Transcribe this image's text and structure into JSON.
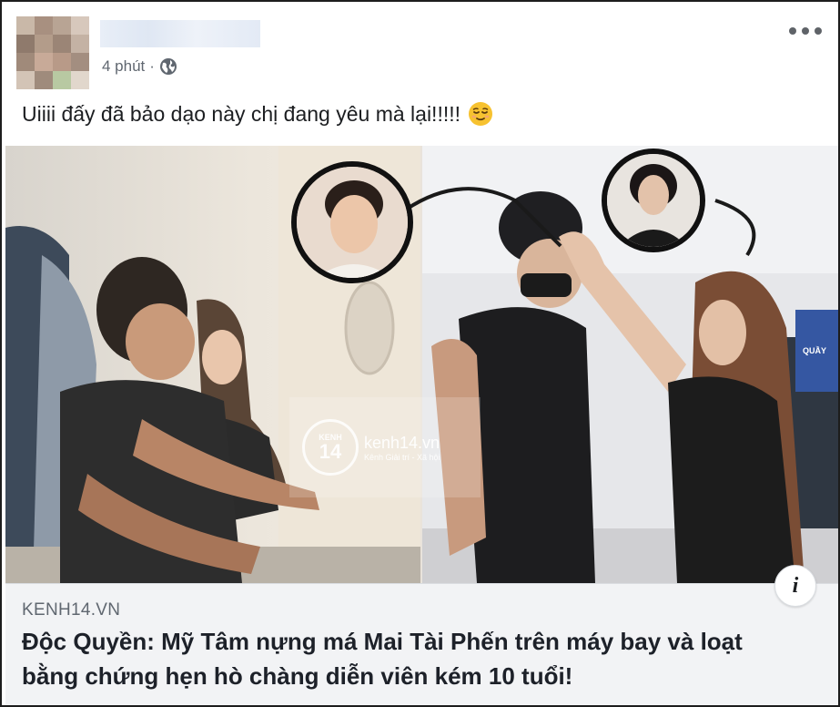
{
  "post": {
    "timestamp": "4 phút",
    "separator": "·",
    "privacy_icon": "globe-icon",
    "more_icon": "more-horizontal-icon",
    "text": "Uiiii đấy đã bảo dạo này chị đang yêu mà lại!!!!!",
    "emoji": "relieved-face-emoji"
  },
  "photo": {
    "watermark_brand": "kenh14.vn",
    "watermark_sub": "Kênh Giải trí - Xã hội",
    "watermark_logo_top": "KENH",
    "watermark_logo_num": "14",
    "sign_text": "QUẦY"
  },
  "link": {
    "domain": "KENH14.VN",
    "title": "Độc Quyền: Mỹ Tâm nựng má Mai Tài Phến trên máy bay và loạt bằng chứng hẹn hò chàng diễn viên kém 10 tuổi!",
    "info_icon": "info-icon",
    "info_label": "i"
  },
  "colors": {
    "border": "#1d1d1d",
    "meta_text": "#606770",
    "preview_bg": "#f2f3f5"
  }
}
